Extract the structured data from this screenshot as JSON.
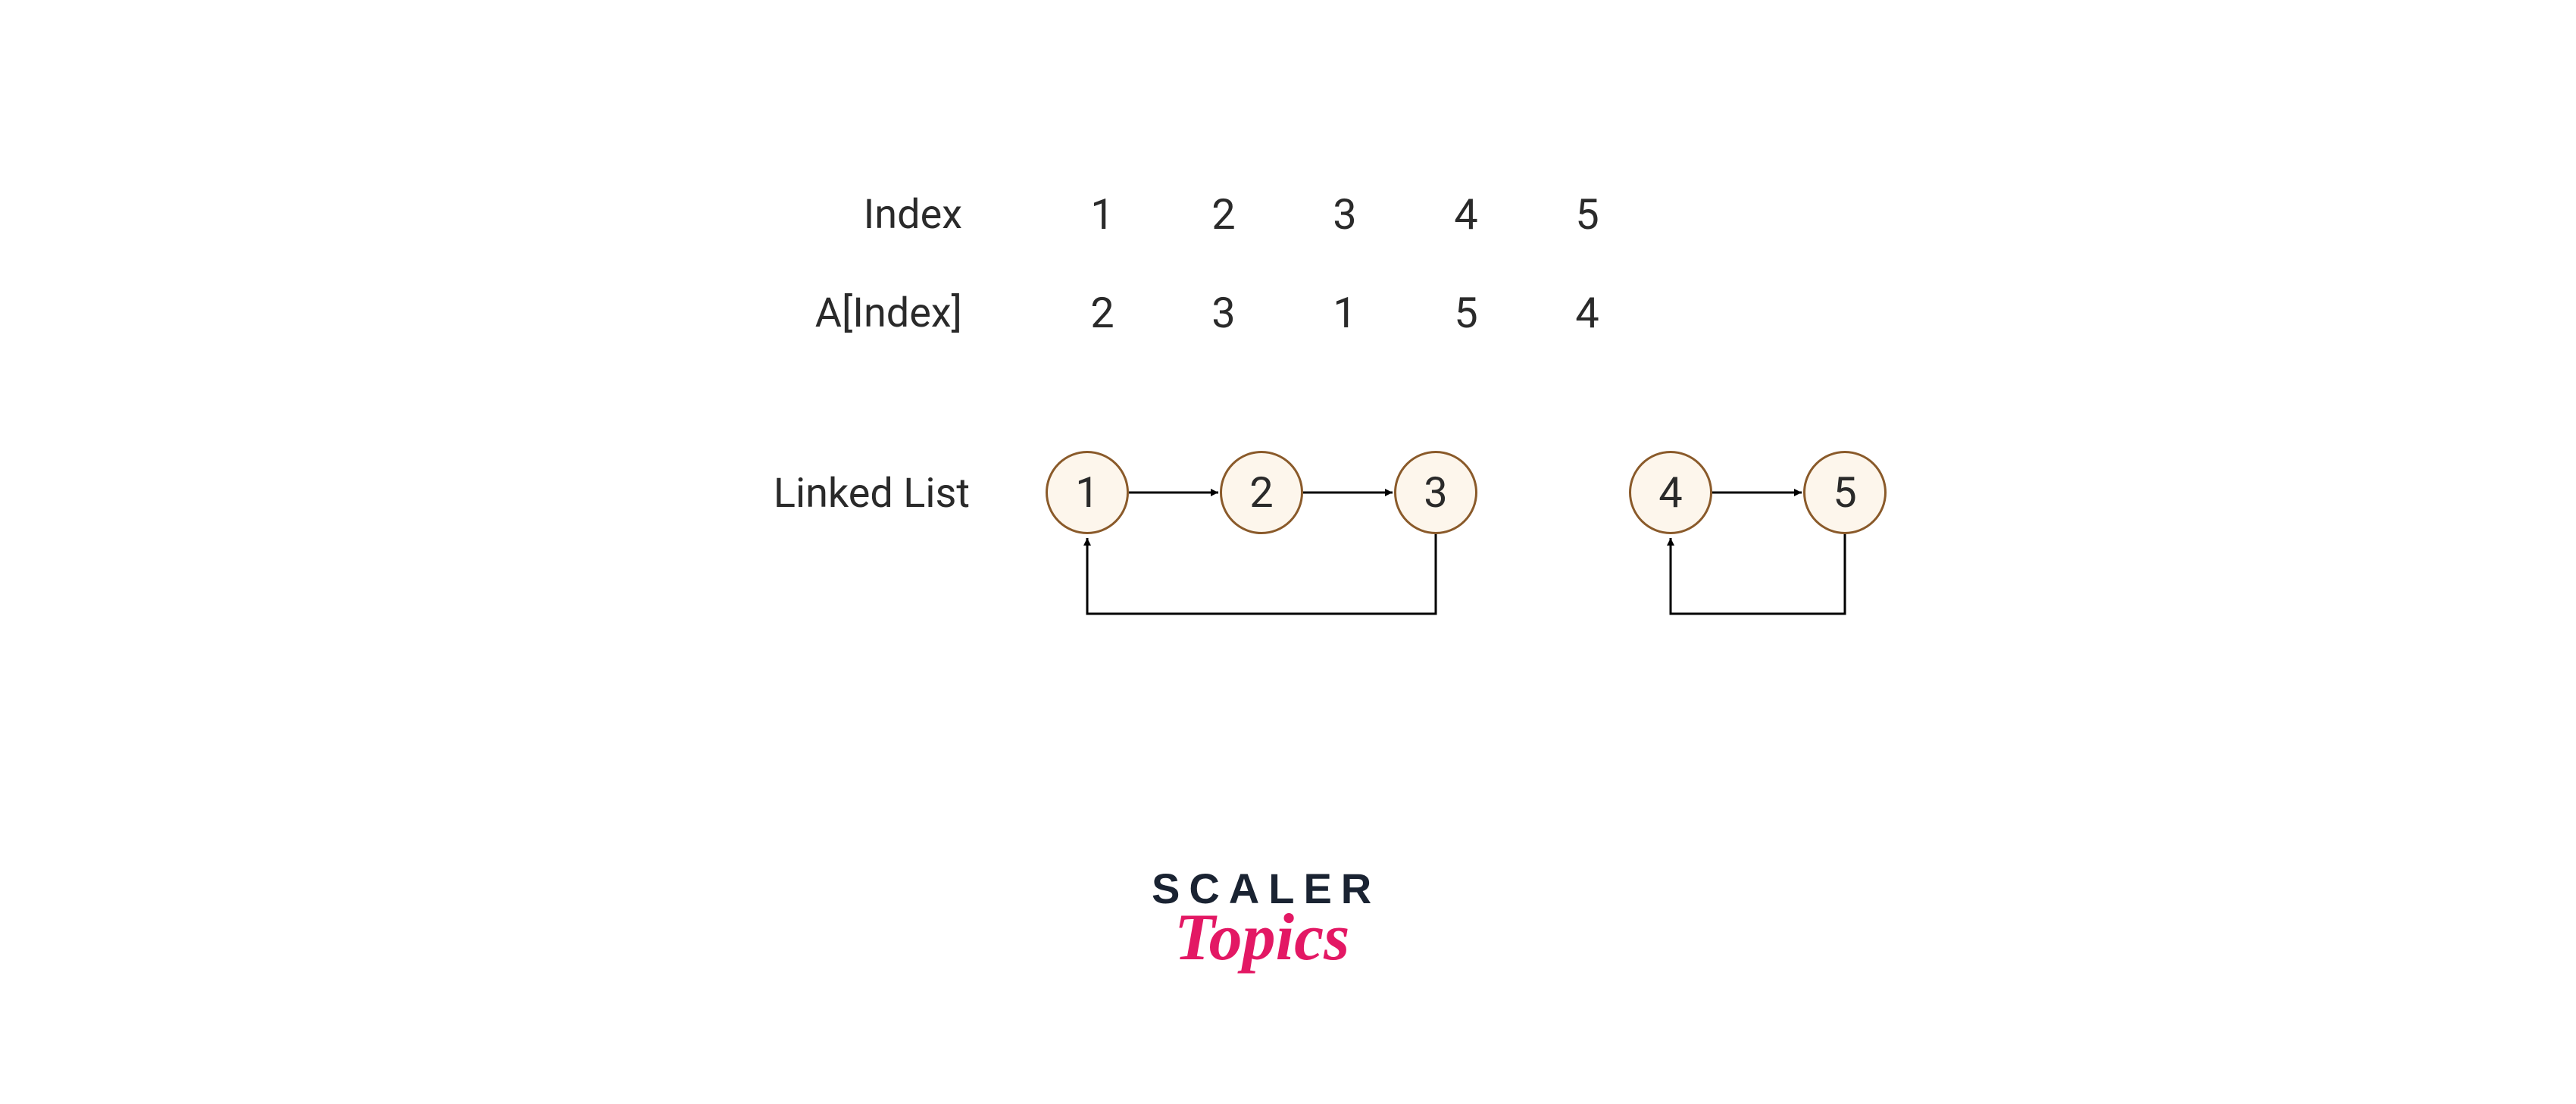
{
  "row1": {
    "label": "Index",
    "values": [
      "1",
      "2",
      "3",
      "4",
      "5"
    ]
  },
  "row2": {
    "label": "A[Index]",
    "values": [
      "2",
      "3",
      "1",
      "5",
      "4"
    ]
  },
  "linked": {
    "label": "Linked List",
    "nodes": [
      "1",
      "2",
      "3",
      "4",
      "5"
    ]
  },
  "logo": {
    "line1": "SCALER",
    "line2": "Topics"
  },
  "colors": {
    "nodeFill": "#fdf6ec",
    "nodeStroke": "#8a5a2a",
    "text": "#2a2a2a",
    "logoDark": "#1a2332",
    "logoPink": "#e31864",
    "arrow": "#000000"
  }
}
